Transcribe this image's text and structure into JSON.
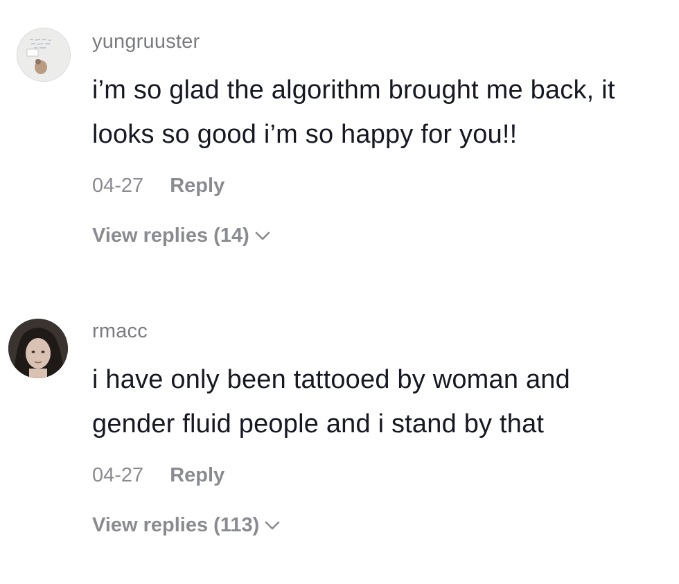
{
  "comments": [
    {
      "username": "yungruuster",
      "text": "i’m so glad the algorithm brought me back, it looks so good i’m so happy for you!!",
      "date": "04-27",
      "reply_label": "Reply",
      "view_replies_label": "View replies (14)",
      "avatar_icon": "avatar-photo-icon"
    },
    {
      "username": "rmacc",
      "text": "i have only been tattooed by woman and gender fluid people and i stand by that",
      "date": "04-27",
      "reply_label": "Reply",
      "view_replies_label": "View replies (113)",
      "avatar_icon": "avatar-photo-icon"
    }
  ],
  "colors": {
    "primary_text": "#161823",
    "secondary_text": "#7a7b82",
    "meta_text": "#8a8b91",
    "background": "#ffffff"
  }
}
